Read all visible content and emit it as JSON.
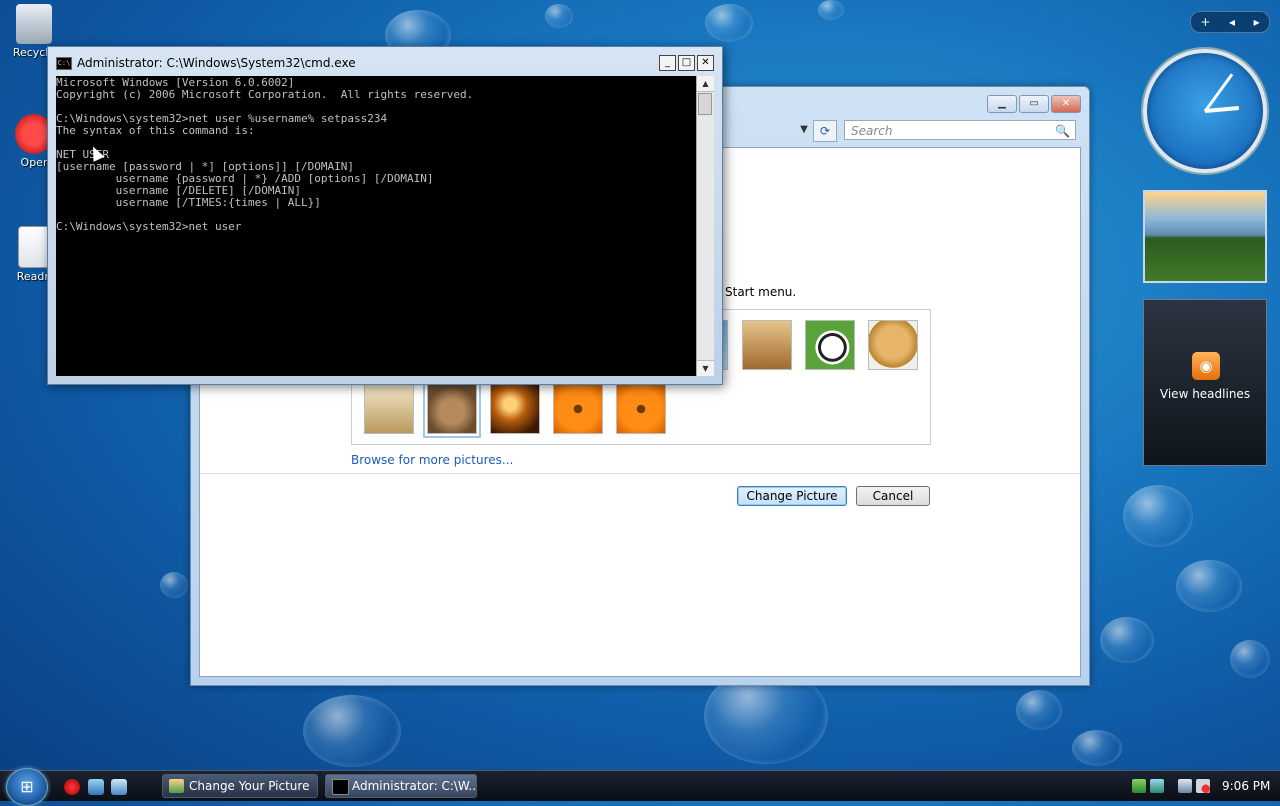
{
  "desktop": {
    "icons": [
      {
        "label": "Recycle",
        "name": "recycle-bin"
      },
      {
        "label": "Oper",
        "name": "opera"
      },
      {
        "label": "Readn",
        "name": "readme"
      }
    ]
  },
  "control_panel": {
    "search_placeholder": "Search",
    "start_menu_text": "Start menu.",
    "browse_link": "Browse for more pictures...",
    "change_picture_label": "Change Picture",
    "cancel_label": "Cancel"
  },
  "cmd": {
    "title": "Administrator: C:\\Windows\\System32\\cmd.exe",
    "lines": [
      "Microsoft Windows [Version 6.0.6002]",
      "Copyright (c) 2006 Microsoft Corporation.  All rights reserved.",
      "",
      "C:\\Windows\\system32>net user %username% setpass234",
      "The syntax of this command is:",
      "",
      "NET USER",
      "[username [password | *] [options]] [/DOMAIN]",
      "         username {password | *} /ADD [options] [/DOMAIN]",
      "         username [/DELETE] [/DOMAIN]",
      "         username [/TIMES:{times | ALL}]",
      "",
      "C:\\Windows\\system32>net user"
    ]
  },
  "sidebar": {
    "feed_label": "View headlines"
  },
  "taskbar": {
    "tasks": [
      {
        "label": "Change Your Picture"
      },
      {
        "label": "Administrator: C:\\W..."
      }
    ],
    "time": "9:06 PM"
  }
}
